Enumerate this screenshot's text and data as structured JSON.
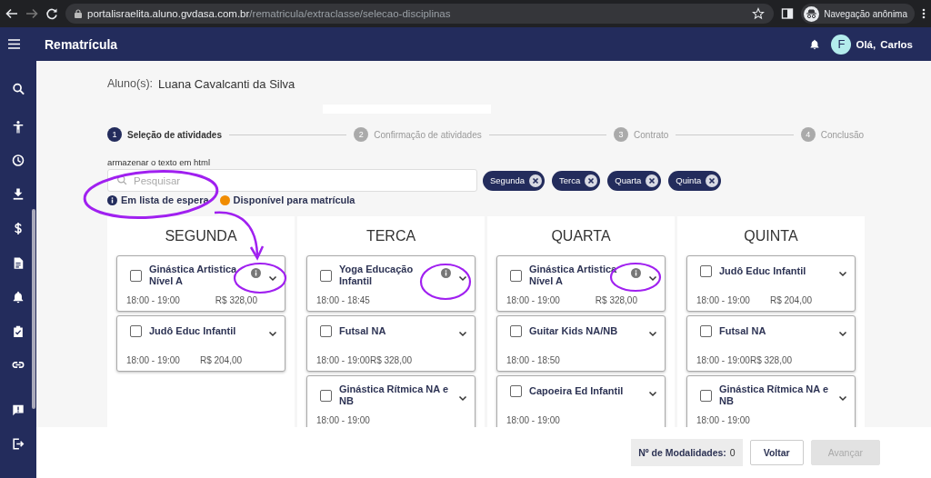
{
  "browser": {
    "url_host": "portalisraelita.aluno.gvdasa.com.br",
    "url_path": "/rematricula/extraclasse/selecao-disciplinas",
    "profile": "Navegação anônima"
  },
  "header": {
    "title": "Rematrícula",
    "avatar": "F",
    "greeting": "Olá,",
    "user": "Carlos"
  },
  "sidebar": {
    "items": [
      {
        "kind": "search"
      },
      {
        "kind": "accessibility"
      },
      {
        "kind": "clock"
      },
      {
        "kind": "download"
      },
      {
        "kind": "dollar"
      },
      {
        "kind": "document"
      },
      {
        "kind": "bell"
      },
      {
        "kind": "clipboard"
      },
      {
        "kind": "link"
      },
      {
        "kind": "chat"
      },
      {
        "kind": "logout"
      }
    ]
  },
  "student": {
    "label": "Aluno(s):",
    "name": "Luana Cavalcanti da Silva"
  },
  "steps": [
    {
      "number": "1",
      "label": "Seleção de atividades",
      "active": true
    },
    {
      "number": "2",
      "label": "Confirmação de atividades",
      "active": false
    },
    {
      "number": "3",
      "label": "Contrato",
      "active": false
    },
    {
      "number": "4",
      "label": "Conclusão",
      "active": false
    }
  ],
  "search": {
    "label": "armazenar o texto em html",
    "placeholder": "Pesquisar"
  },
  "filters": [
    "Segunda",
    "Terca",
    "Quarta",
    "Quinta"
  ],
  "legend": [
    {
      "kind": "waitlist",
      "label": "Em lista de espera"
    },
    {
      "kind": "available",
      "label": "Disponível para matrícula"
    }
  ],
  "days": [
    {
      "title": "SEGUNDA",
      "activities": [
        {
          "name": "Ginástica Artistica Nível A",
          "time": "18:00 - 19:00",
          "price": "R$ 328,00",
          "waitlist": true,
          "checked": false
        },
        {
          "name": "Judô Educ Infantil",
          "time": "18:00 - 19:00",
          "price": "R$ 204,00",
          "waitlist": false,
          "checked": false
        }
      ]
    },
    {
      "title": "TERCA",
      "activities": [
        {
          "name": "Yoga Educação Infantil",
          "time": "18:00 - 18:45",
          "waitlist": true,
          "checked": false
        },
        {
          "name": "Futsal NA",
          "time": "18:00 - 19:00R$ 328,00",
          "waitlist": false,
          "checked": false
        },
        {
          "name": "Ginástica Rítmica NA e NB",
          "time": "18:00 - 19:00",
          "waitlist": false,
          "checked": false
        }
      ]
    },
    {
      "title": "QUARTA",
      "activities": [
        {
          "name": "Ginástica Artistica Nível A",
          "time": "18:00 - 19:00",
          "price": "R$ 328,00",
          "waitlist": true,
          "checked": false
        },
        {
          "name": "Guitar Kids NA/NB",
          "time": "18:00 - 18:50",
          "waitlist": false,
          "checked": false
        },
        {
          "name": "Capoeira Ed Infantil",
          "time": "18:00 - 19:00",
          "waitlist": false,
          "checked": false
        }
      ]
    },
    {
      "title": "QUINTA",
      "activities": [
        {
          "name": "Judô Educ Infantil",
          "time": "18:00 - 19:00",
          "price": "R$ 204,00",
          "waitlist": false,
          "checked": false
        },
        {
          "name": "Futsal NA",
          "time": "18:00 - 19:00R$ 328,00",
          "waitlist": false,
          "checked": false
        },
        {
          "name": "Ginástica Rítmica NA e NB",
          "time": "18:00 - 19:00",
          "waitlist": false,
          "checked": false
        }
      ]
    }
  ],
  "footer": {
    "count_label": "Nº de Modalidades:",
    "count": "0",
    "buttons": [
      {
        "label": "Voltar",
        "disabled": false
      },
      {
        "label": "Avançar",
        "disabled": true
      }
    ]
  }
}
